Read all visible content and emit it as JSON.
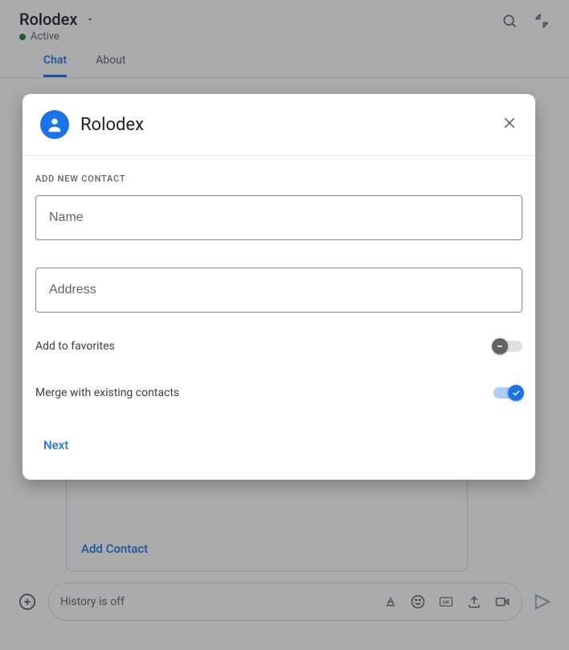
{
  "header": {
    "title": "Rolodex",
    "status_label": "Active",
    "status_color": "#188038"
  },
  "tabs": [
    {
      "label": "Chat",
      "active": true
    },
    {
      "label": "About",
      "active": false
    }
  ],
  "card": {
    "action_label": "Add Contact"
  },
  "composer": {
    "placeholder": "History is off"
  },
  "dialog": {
    "title": "Rolodex",
    "section_label": "ADD NEW CONTACT",
    "fields": {
      "name": {
        "placeholder": "Name",
        "value": ""
      },
      "address": {
        "placeholder": "Address",
        "value": ""
      }
    },
    "toggles": {
      "favorites": {
        "label": "Add to favorites",
        "on": false
      },
      "merge": {
        "label": "Merge with existing contacts",
        "on": true
      }
    },
    "action_label": "Next"
  },
  "icons": {
    "dropdown": "caret-down-icon",
    "search": "search-icon",
    "collapse": "collapse-icon",
    "plus": "plus-circle-icon",
    "format": "text-format-icon",
    "emoji": "emoji-icon",
    "gif": "gif-icon",
    "upload": "upload-icon",
    "video": "video-icon",
    "send": "send-icon",
    "person": "person-icon",
    "close": "close-icon",
    "minus": "minus-icon",
    "check": "check-icon"
  },
  "colors": {
    "accent": "#1a73e8",
    "text_primary": "#202124",
    "text_secondary": "#5f6368"
  }
}
